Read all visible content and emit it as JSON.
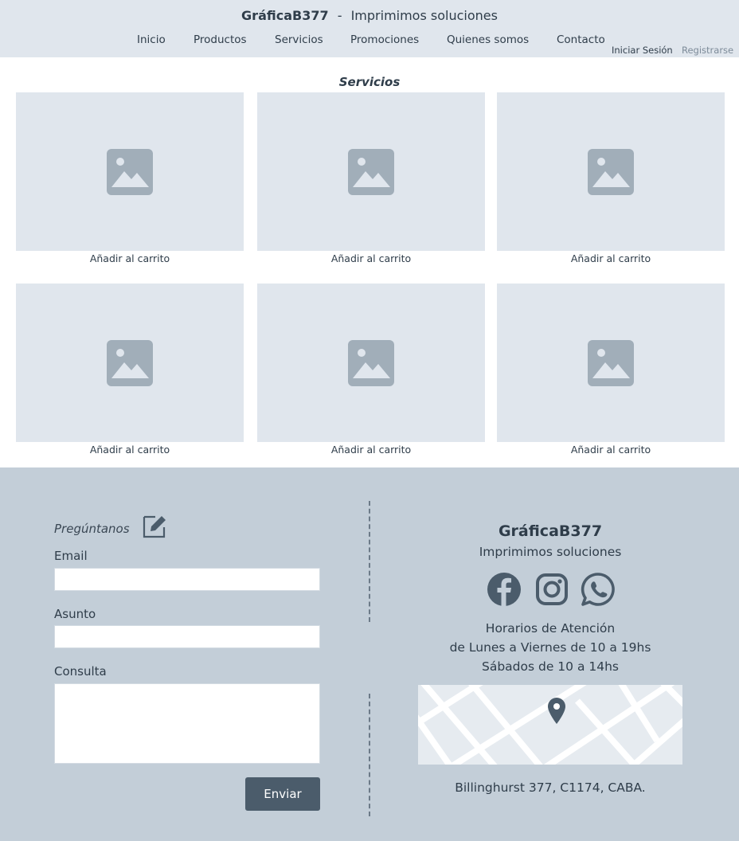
{
  "header": {
    "brand": "GráficaB377",
    "separator": "-",
    "tagline": "Imprimimos soluciones",
    "nav": [
      "Inicio",
      "Productos",
      "Servicios",
      "Promociones",
      "Quienes somos",
      "Contacto"
    ],
    "login": "Iniciar Sesión",
    "register": "Registrarse"
  },
  "main": {
    "title": "Servicios",
    "cards": [
      {
        "action": "Añadir al carrito"
      },
      {
        "action": "Añadir al carrito"
      },
      {
        "action": "Añadir al carrito"
      },
      {
        "action": "Añadir al carrito"
      },
      {
        "action": "Añadir al carrito"
      },
      {
        "action": "Añadir al carrito"
      }
    ],
    "card_icon": "image-placeholder-icon"
  },
  "footer": {
    "form": {
      "title": "Pregúntanos",
      "title_icon": "edit-icon",
      "email_label": "Email",
      "email_value": "",
      "subject_label": "Asunto",
      "subject_value": "",
      "query_label": "Consulta",
      "query_value": "",
      "submit": "Enviar"
    },
    "info": {
      "brand": "GráficaB377",
      "tagline": "Imprimimos soluciones",
      "social_icons": [
        "facebook-icon",
        "instagram-icon",
        "whatsapp-icon"
      ],
      "hours_title": "Horarios de Atención",
      "hours_week": "de Lunes a Viernes de 10 a 19hs",
      "hours_sat": "Sábados de 10 a 14hs",
      "map_icon": "map-pin-icon",
      "address": "Billinghurst 377, C1174, CABA."
    }
  },
  "colors": {
    "header_bg": "#e0e6ed",
    "footer_bg": "#c3ced8",
    "placeholder_bg": "#e0e6ed",
    "icon": "#4b5c6b",
    "button": "#4b5c6b"
  }
}
